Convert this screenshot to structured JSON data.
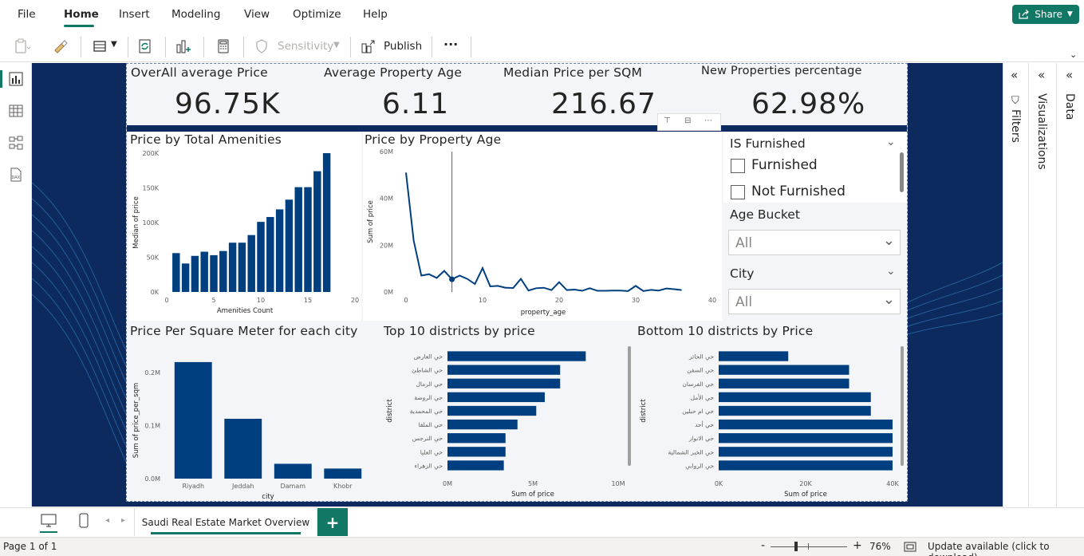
{
  "menu": {
    "items": [
      "File",
      "Home",
      "Insert",
      "Modeling",
      "View",
      "Optimize",
      "Help"
    ],
    "share": "Share"
  },
  "toolbar": {
    "sensitivity": "Sensitivity",
    "publish": "Publish",
    "more": "···"
  },
  "kpis": [
    {
      "title": "OverAll average Price",
      "value": "96.75K"
    },
    {
      "title": "Average Property Age",
      "value": "6.11"
    },
    {
      "title": "Median Price per SQM",
      "value": "216.67"
    },
    {
      "title": "New Properties percentage",
      "value": "62.98%"
    }
  ],
  "slicers": {
    "furnished": {
      "title": "IS Furnished",
      "options": [
        "Furnished",
        "Not Furnished"
      ]
    },
    "age_bucket": {
      "title": "Age Bucket",
      "value": "All"
    },
    "city": {
      "title": "City",
      "value": "All"
    }
  },
  "panes": {
    "filters": "Filters",
    "visualizations": "Visualizations",
    "data": "Data"
  },
  "page_tab": "Saudi Real Estate Market Overview",
  "status": {
    "page": "Page 1 of 1",
    "zoom": "76%",
    "update": "Update available (click to download)"
  },
  "colors": {
    "bar": "#003f7f",
    "accent": "#117865",
    "canvas_bg": "#0c2a5e"
  },
  "chart_data": [
    {
      "type": "bar",
      "title": "Price by Total Amenities",
      "xlabel": "Amenities Count",
      "ylabel": "Median of price",
      "x": [
        1,
        2,
        3,
        4,
        5,
        6,
        7,
        8,
        9,
        10,
        11,
        12,
        13,
        14,
        15,
        16
      ],
      "values": [
        56000,
        41000,
        52000,
        58000,
        53000,
        59000,
        71000,
        71000,
        82000,
        101000,
        108000,
        119000,
        133000,
        151000,
        151000,
        174000,
        200000
      ],
      "xlim": [
        0,
        20
      ],
      "ylim": [
        0,
        200000
      ],
      "xticks": [
        "0",
        "5",
        "10",
        "15",
        "20"
      ],
      "yticks": [
        "0K",
        "50K",
        "100K",
        "150K",
        "200K"
      ]
    },
    {
      "type": "line",
      "title": "Price by Property Age",
      "xlabel": "property_age",
      "ylabel": "Sum of price",
      "x": [
        0,
        1,
        2,
        3,
        4,
        5,
        6,
        7,
        8,
        9,
        10,
        11,
        12,
        13,
        14,
        15,
        16,
        17,
        18,
        19,
        20,
        21,
        22,
        23,
        24,
        25,
        26,
        27,
        28,
        29,
        30,
        31,
        32,
        33,
        34,
        35,
        36
      ],
      "values": [
        51000000,
        22000000,
        7000000,
        7600000,
        6000000,
        9000000,
        5400000,
        7000000,
        5600000,
        3400000,
        10200000,
        2400000,
        2600000,
        1800000,
        1700000,
        5600000,
        600000,
        1600000,
        1800000,
        800000,
        4200000,
        800000,
        1000000,
        500000,
        1600000,
        500000,
        500000,
        600000,
        600000,
        400000,
        2600000,
        400000,
        900000,
        600000,
        1500000,
        1200000,
        800000
      ],
      "xlim": [
        0,
        40
      ],
      "ylim": [
        0,
        60000000
      ],
      "xticks": [
        "0",
        "10",
        "20",
        "30",
        "40"
      ],
      "yticks": [
        "0M",
        "20M",
        "40M",
        "60M"
      ],
      "highlight_x": 6
    },
    {
      "type": "bar",
      "title": "Price Per Square Meter for each city",
      "xlabel": "city",
      "ylabel": "Sum of price_per_sqm",
      "categories": [
        "Riyadh",
        "Jeddah",
        "Damam",
        "Khobr"
      ],
      "values": [
        220000,
        113000,
        28000,
        19000
      ],
      "ylim": [
        0,
        250000
      ],
      "yticks": [
        "0.0M",
        "0.1M",
        "0.2M"
      ]
    },
    {
      "type": "bar",
      "title": "Top 10 districts by price",
      "xlabel": "Sum of price",
      "ylabel": "district",
      "categories": [
        "حي العارض",
        "حي الشاطئ",
        "حي الرمال",
        "حي الروضة",
        "حي المحمدية",
        "حي الملقا",
        "حي النرجس",
        "حي العليا",
        "حي الزهراء"
      ],
      "values": [
        8100000,
        6600000,
        6600000,
        5700000,
        5200000,
        4100000,
        3400000,
        3400000,
        3300000
      ],
      "xlim": [
        0,
        10000000
      ],
      "xticks": [
        "0M",
        "5M",
        "10M"
      ]
    },
    {
      "type": "bar",
      "title": "Bottom 10 districts by Price",
      "xlabel": "Sum of price",
      "ylabel": "district",
      "categories": [
        "حي الحائر",
        "حي السفن",
        "حي الفرسان",
        "حي الأمل",
        "حي ام حبلين",
        "حي أحد",
        "حي الانوار",
        "حي الخبر الشمالية",
        "حي الروابي"
      ],
      "values": [
        16000,
        30000,
        30000,
        35000,
        35000,
        40000,
        40000,
        40000,
        40000
      ],
      "xlim": [
        0,
        40000
      ],
      "xticks": [
        "0K",
        "20K",
        "40K"
      ]
    }
  ]
}
